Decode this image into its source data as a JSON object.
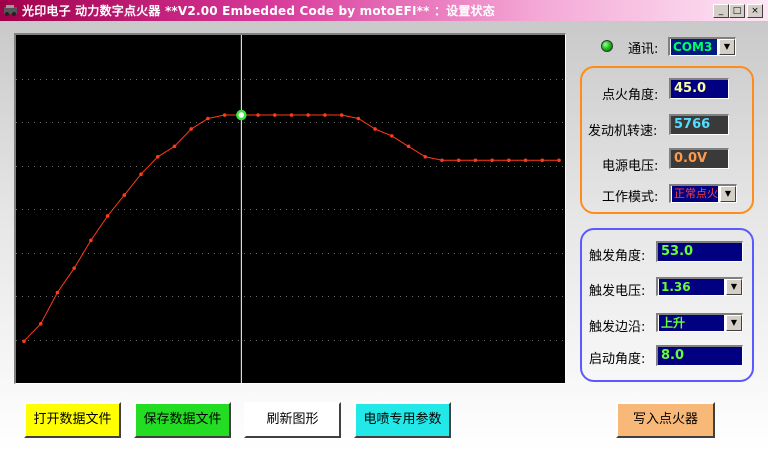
{
  "window": {
    "title": "光印电子 动力数字点火器  **V2.00 Embedded Code by motoEFI**  ：设置状态",
    "controls": [
      "_",
      "□",
      "×"
    ]
  },
  "comm": {
    "label": "通讯:",
    "port": "COM3",
    "status_color": "#19c419"
  },
  "ignition_panel": {
    "border_color": "#ff8c1a",
    "angle": {
      "label": "点火角度:",
      "value": "45.0"
    },
    "rpm": {
      "label": "发动机转速:",
      "value": "5766"
    },
    "voltage": {
      "label": "电源电压:",
      "value": "0.0V"
    },
    "mode": {
      "label": "工作模式:",
      "value": "正常点火"
    }
  },
  "trigger_panel": {
    "border_color": "#5a5aff",
    "angle": {
      "label": "触发角度:",
      "value": "53.0"
    },
    "voltage": {
      "label": "触发电压:",
      "value": "1.36"
    },
    "edge": {
      "label": "触发边沿:",
      "value": "上升"
    },
    "start_angle": {
      "label": "启动角度:",
      "value": "8.0"
    }
  },
  "buttons": {
    "open_file": "打开数据文件",
    "save_file": "保存数据文件",
    "refresh": "刷新图形",
    "injector_params": "电喷专用参数",
    "write_igniter": "写入点火器"
  },
  "chart_data": {
    "type": "line",
    "x": [
      0,
      1,
      2,
      3,
      4,
      5,
      6,
      7,
      8,
      9,
      10,
      11,
      12,
      13,
      14,
      15,
      16,
      17,
      18,
      19,
      20,
      21,
      22,
      23,
      24,
      25,
      26,
      27,
      28,
      29,
      30,
      31,
      32
    ],
    "values": [
      0.12,
      0.17,
      0.26,
      0.33,
      0.41,
      0.48,
      0.54,
      0.6,
      0.65,
      0.68,
      0.73,
      0.76,
      0.77,
      0.77,
      0.77,
      0.77,
      0.77,
      0.77,
      0.77,
      0.77,
      0.76,
      0.73,
      0.71,
      0.68,
      0.65,
      0.64,
      0.64,
      0.64,
      0.64,
      0.64,
      0.64,
      0.64,
      0.64
    ],
    "xlim": [
      0,
      32
    ],
    "ylim": [
      0,
      1
    ],
    "cursor_index": 13,
    "grid": true,
    "line_color": "#ff3a1a",
    "cursor_color": "#ffffff",
    "highlight_color": "#39e639"
  }
}
